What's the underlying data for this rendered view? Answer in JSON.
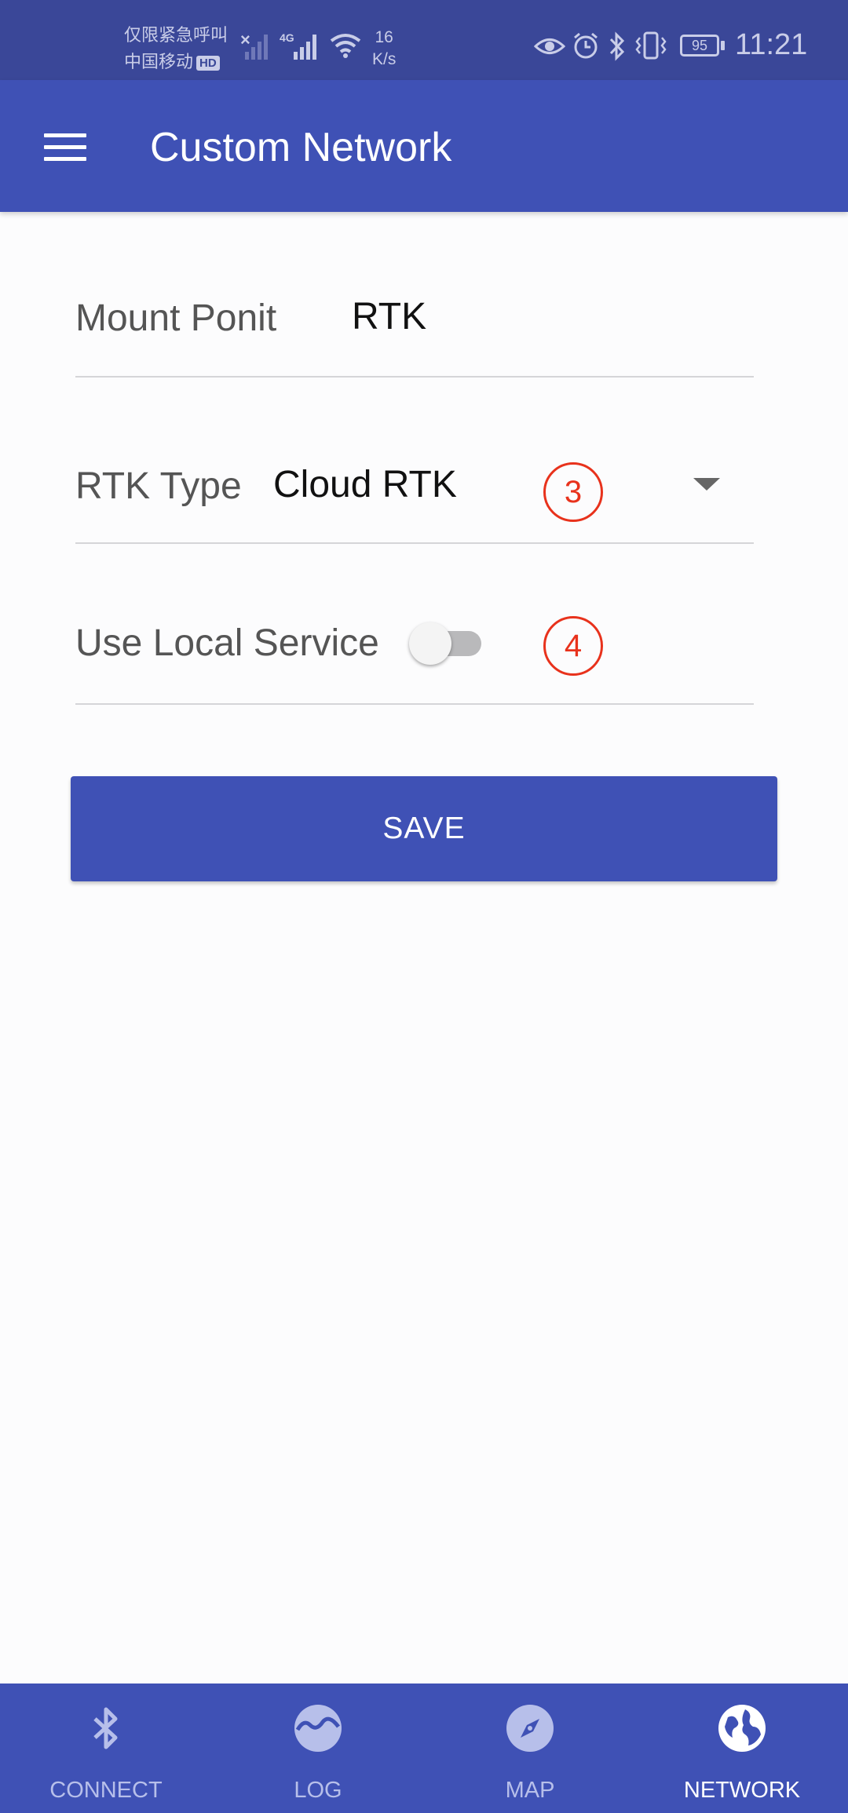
{
  "status_bar": {
    "carrier_line1": "仅限紧急呼叫",
    "carrier_line2": "中国移动",
    "hd_badge": "HD",
    "network_type": "4G",
    "speed_value": "16",
    "speed_unit": "K/s",
    "battery": "95",
    "time": "11:21",
    "icons": [
      "eye-icon",
      "alarm-icon",
      "bluetooth-icon",
      "vibrate-icon"
    ]
  },
  "app_bar": {
    "title": "Custom Network",
    "menu_icon": "hamburger-menu-icon"
  },
  "form": {
    "mount_point": {
      "label": "Mount Ponit",
      "value": "RTK"
    },
    "rtk_type": {
      "label": "RTK Type",
      "value": "Cloud RTK",
      "annotation": "3"
    },
    "local_service": {
      "label": "Use Local Service",
      "enabled": false,
      "annotation": "4"
    },
    "save_label": "SAVE"
  },
  "bottom_nav": {
    "active": "NETWORK",
    "items": [
      {
        "label": "CONNECT",
        "icon": "bluetooth-icon"
      },
      {
        "label": "LOG",
        "icon": "log-icon"
      },
      {
        "label": "MAP",
        "icon": "compass-icon"
      },
      {
        "label": "NETWORK",
        "icon": "globe-icon"
      }
    ]
  },
  "colors": {
    "primary": "#3f51b5",
    "status_bar": "#3a4798",
    "annotation": "#e8321c"
  }
}
